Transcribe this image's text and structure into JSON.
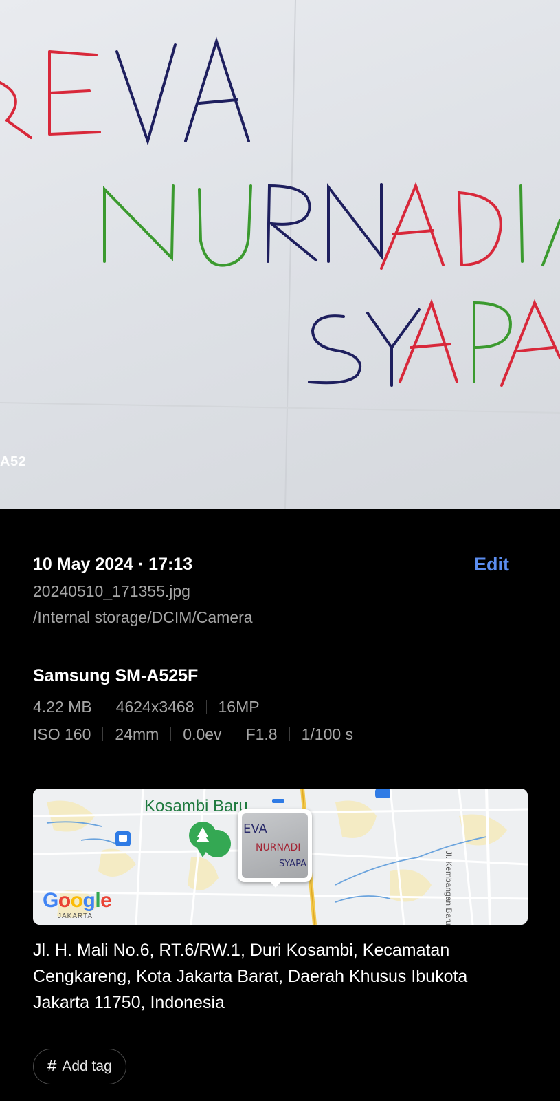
{
  "photo": {
    "overlay_text": "A52",
    "handwriting": {
      "line1": "REVA",
      "line2": "NURNADIA",
      "line3": "SYAPA"
    }
  },
  "details": {
    "date_time": "10 May 2024 · 17:13",
    "edit_label": "Edit",
    "filename": "20240510_171355.jpg",
    "path": "/Internal storage/DCIM/Camera",
    "device": "Samsung SM-A525F",
    "specs_row1": [
      "4.22 MB",
      "4624x3468",
      "16MP"
    ],
    "specs_row2": [
      "ISO 160",
      "24mm",
      "0.0ev",
      "F1.8",
      "1/100 s"
    ]
  },
  "map": {
    "place_label": "Kosambi Baru",
    "road_label": "Jl. Kembangan Baru",
    "logo": "Google",
    "corner_label": "JAKARTA",
    "thumb_text": [
      "EVA",
      "NURNADI",
      "SYAPA"
    ]
  },
  "location": {
    "address": "Jl. H. Mali No.6, RT.6/RW.1, Duri Kosambi, Kecamatan Cengkareng, Kota Jakarta Barat, Daerah Khusus Ibukota Jakarta 11750, Indonesia"
  },
  "tag": {
    "icon": "hash-icon",
    "label": "Add tag"
  },
  "colors": {
    "accent": "#5b8def",
    "ink_red": "#d8283a",
    "ink_blue": "#1e1f5e",
    "ink_green": "#3b9a2f"
  }
}
